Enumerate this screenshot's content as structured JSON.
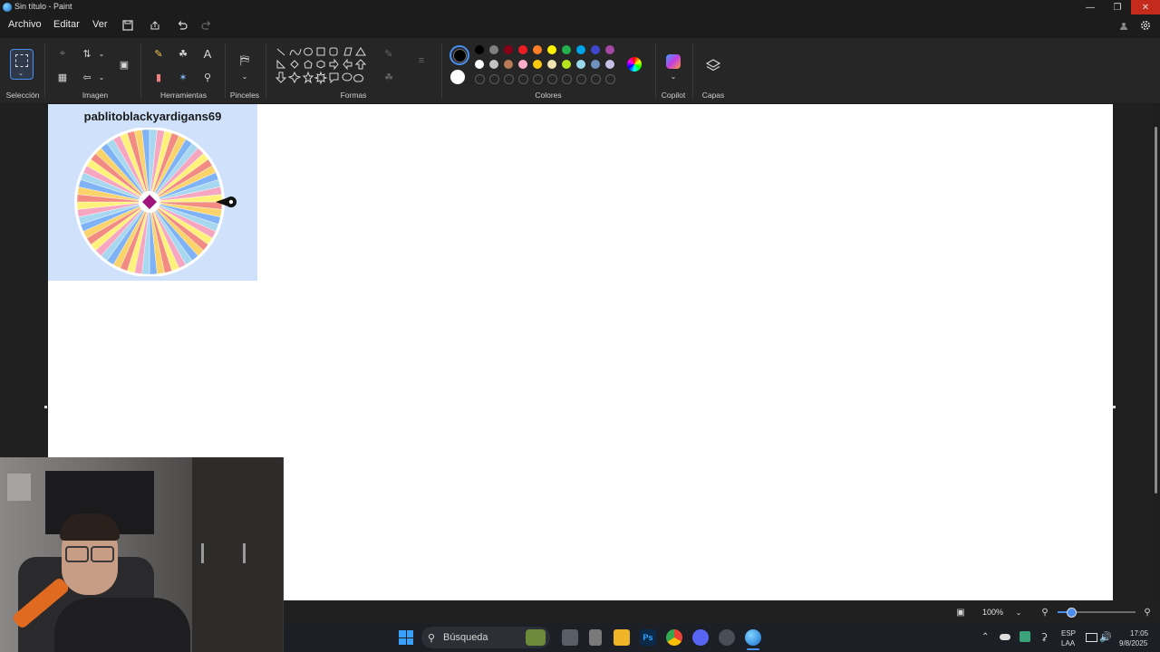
{
  "window": {
    "title": "Sin título - Paint"
  },
  "menu": {
    "items": [
      "Archivo",
      "Editar",
      "Ver"
    ]
  },
  "ribbon": {
    "groups": {
      "seleccion": "Selección",
      "imagen": "Imagen",
      "herramientas": "Herramientas",
      "pinceles": "Pinceles",
      "formas": "Formas",
      "colores": "Colores",
      "copilot": "Copilot",
      "capas": "Capas"
    },
    "colors": {
      "primary": "#000000",
      "secondary": "#ffffff",
      "row1": [
        "#000000",
        "#7f7f7f",
        "#880015",
        "#ed1c24",
        "#ff7f27",
        "#fff200",
        "#22b14c",
        "#00a2e8",
        "#3f48cc",
        "#a349a4"
      ],
      "row2": [
        "#ffffff",
        "#c3c3c3",
        "#b97a57",
        "#ffaec9",
        "#ffc90e",
        "#efe4b0",
        "#b5e61d",
        "#99d9ea",
        "#7092be",
        "#c8bfe7"
      ]
    }
  },
  "canvas": {
    "wheel_title": "pablitoblackyardigans69",
    "wheel_colors": [
      "#f28b82",
      "#fbd36b",
      "#7fb3f5",
      "#a8d8f0",
      "#f6a6c1",
      "#fff27a"
    ]
  },
  "status": {
    "zoom": "100%"
  },
  "taskbar": {
    "search": "Búsqueda",
    "lang_top": "ESP",
    "lang_bottom": "LAA",
    "time": "17:05",
    "date": "9/8/2025"
  }
}
